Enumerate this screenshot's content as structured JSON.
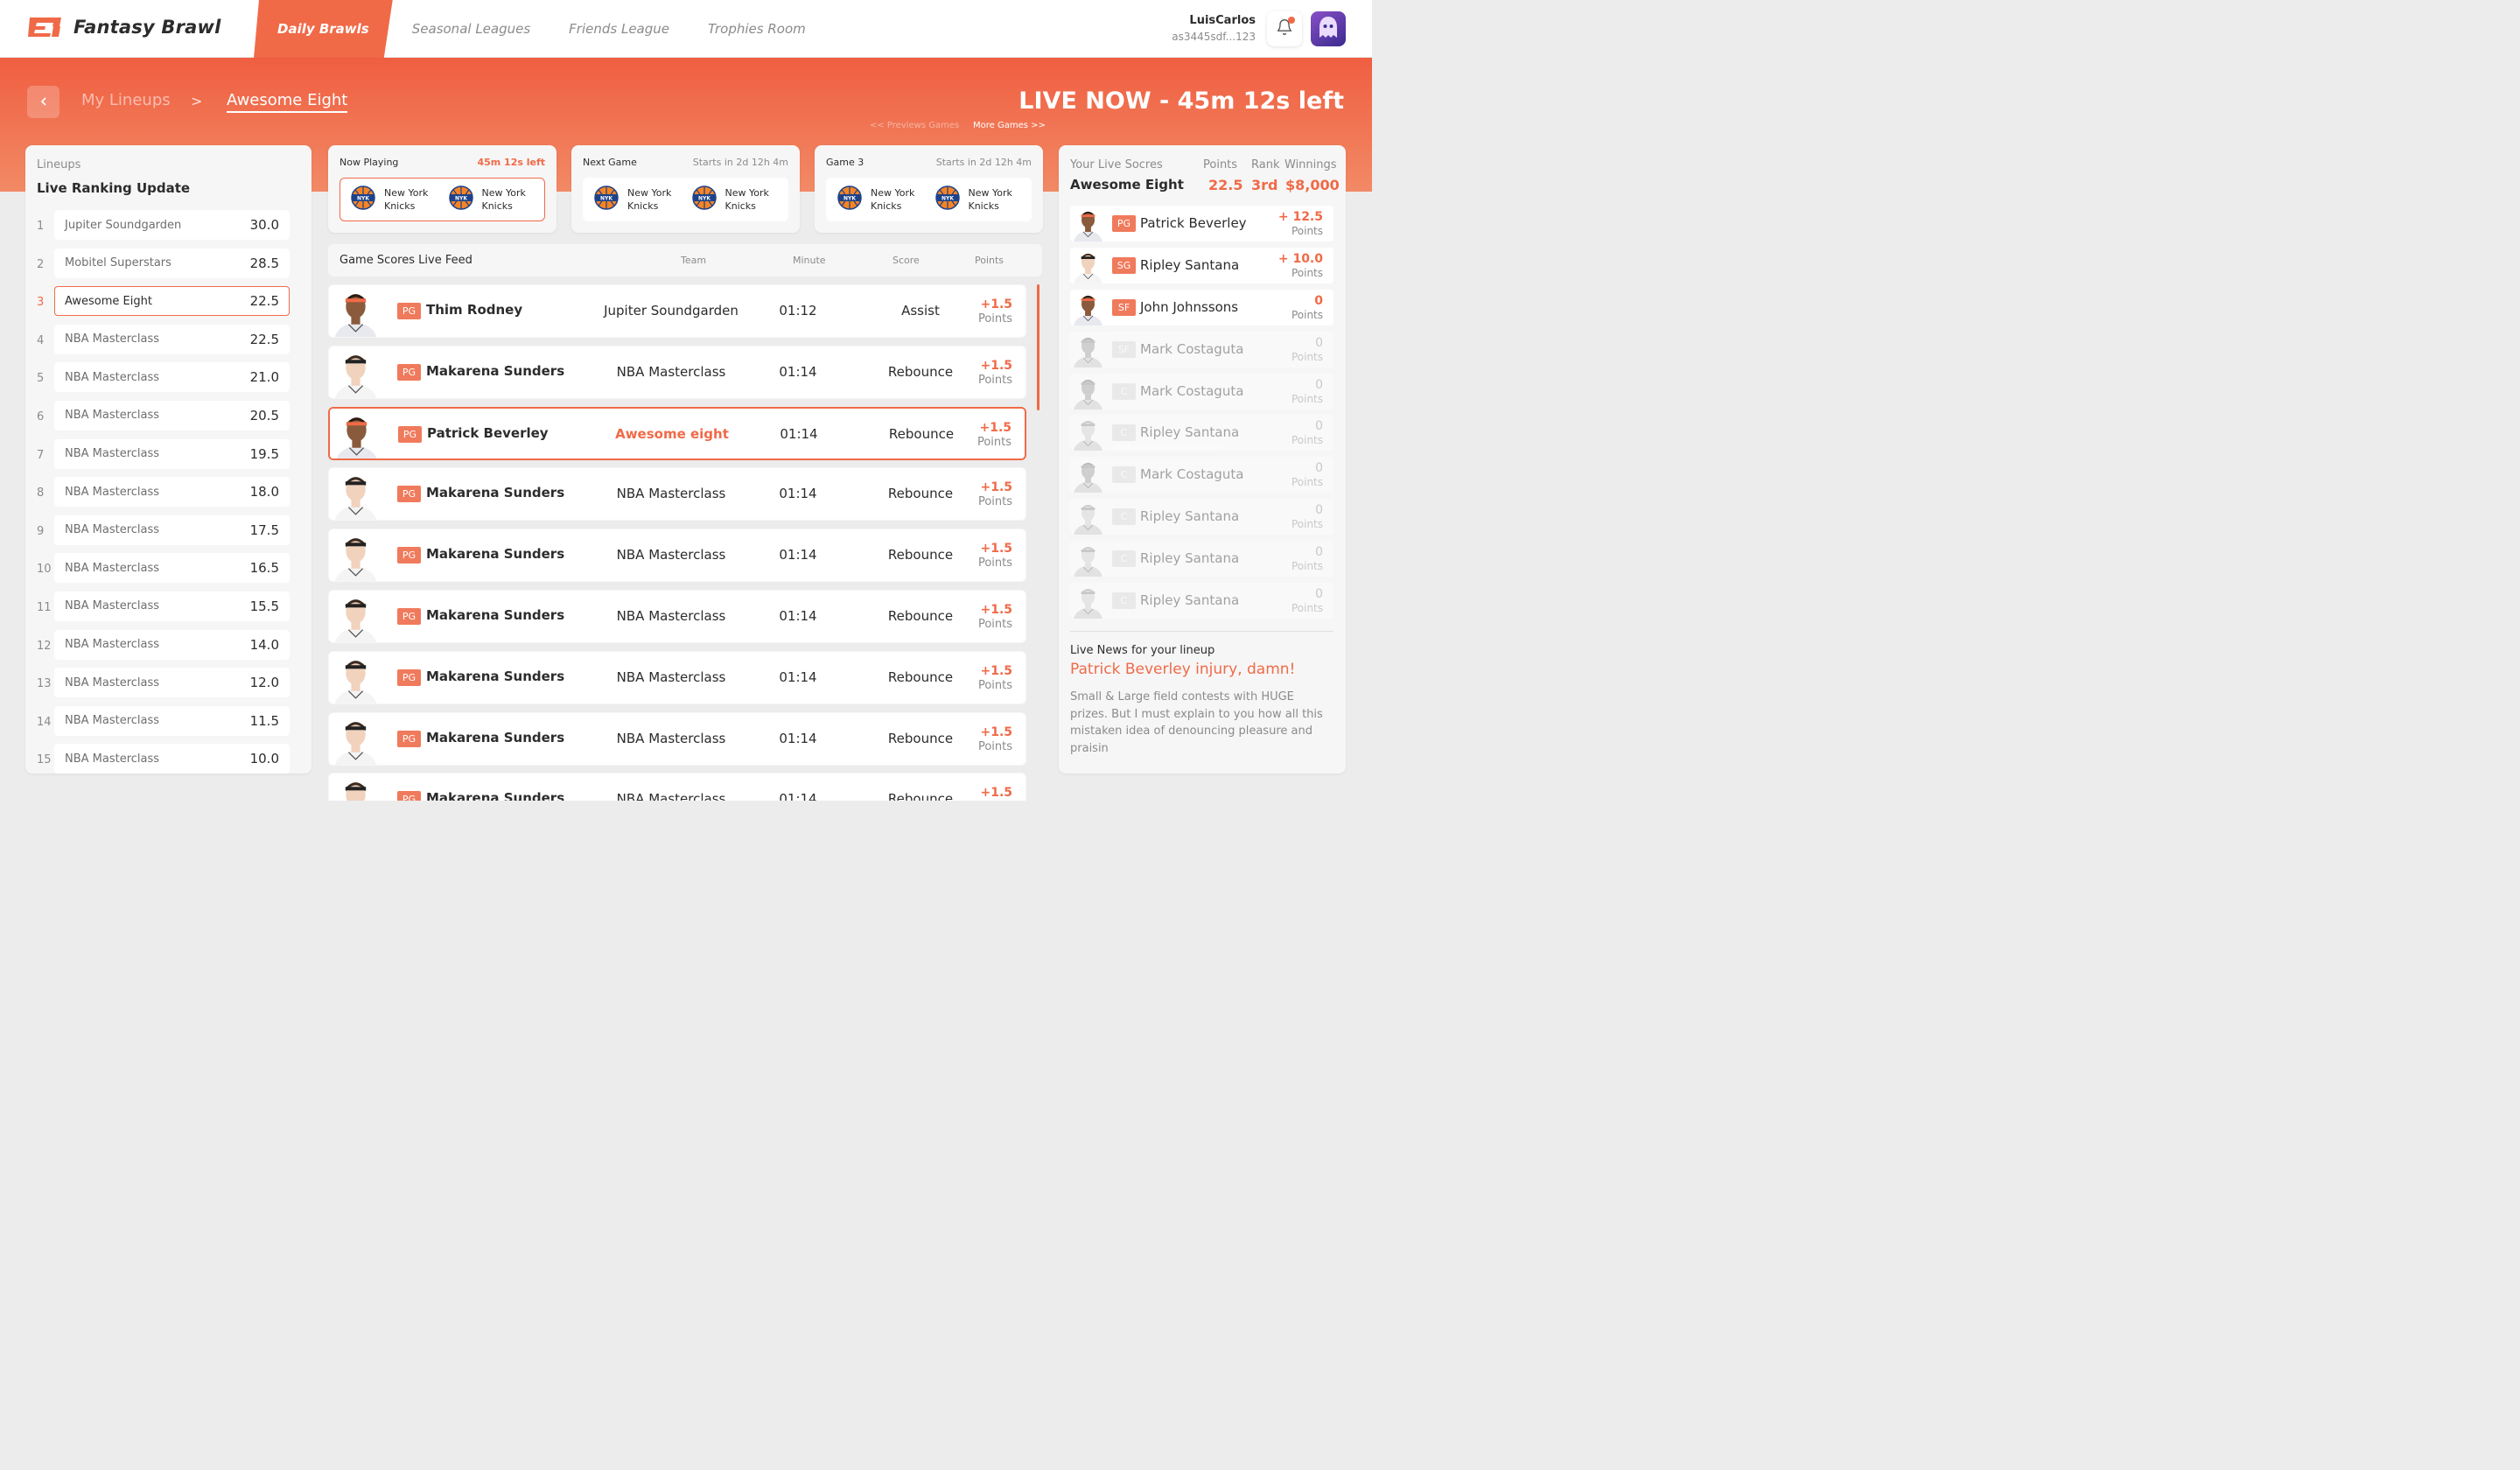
{
  "app": {
    "name": "Fantasy Brawl"
  },
  "nav": [
    {
      "label": "Daily Brawls",
      "active": true
    },
    {
      "label": "Seasonal Leagues",
      "active": false
    },
    {
      "label": "Friends League",
      "active": false
    },
    {
      "label": "Trophies Room",
      "active": false
    }
  ],
  "user": {
    "name": "LuisCarlos",
    "id": "as3445sdf...123"
  },
  "breadcrumb": {
    "parent": "My Lineups",
    "separator": ">",
    "current": "Awesome Eight"
  },
  "live_status": "LIVE NOW - 45m 12s left",
  "games_nav": {
    "prev": "<< Previews Games",
    "more": "More Games >>"
  },
  "rankings": {
    "subtitle": "Lineups",
    "title": "Live Ranking Update",
    "rows": [
      {
        "rank": "1",
        "name": "Jupiter Soundgarden",
        "score": "30.0",
        "active": false
      },
      {
        "rank": "2",
        "name": "Mobitel Superstars",
        "score": "28.5",
        "active": false
      },
      {
        "rank": "3",
        "name": "Awesome Eight",
        "score": "22.5",
        "active": true
      },
      {
        "rank": "4",
        "name": "NBA Masterclass",
        "score": "22.5",
        "active": false
      },
      {
        "rank": "5",
        "name": "NBA Masterclass",
        "score": "21.0",
        "active": false
      },
      {
        "rank": "6",
        "name": "NBA Masterclass",
        "score": "20.5",
        "active": false
      },
      {
        "rank": "7",
        "name": "NBA Masterclass",
        "score": "19.5",
        "active": false
      },
      {
        "rank": "8",
        "name": "NBA Masterclass",
        "score": "18.0",
        "active": false
      },
      {
        "rank": "9",
        "name": "NBA Masterclass",
        "score": "17.5",
        "active": false
      },
      {
        "rank": "10",
        "name": "NBA Masterclass",
        "score": "16.5",
        "active": false
      },
      {
        "rank": "11",
        "name": "NBA Masterclass",
        "score": "15.5",
        "active": false
      },
      {
        "rank": "12",
        "name": "NBA Masterclass",
        "score": "14.0",
        "active": false
      },
      {
        "rank": "13",
        "name": "NBA Masterclass",
        "score": "12.0",
        "active": false
      },
      {
        "rank": "14",
        "name": "NBA Masterclass",
        "score": "11.5",
        "active": false
      },
      {
        "rank": "15",
        "name": "NBA Masterclass",
        "score": "10.0",
        "active": false
      }
    ]
  },
  "games": [
    {
      "label": "Now Playing",
      "time": "45m 12s left",
      "live": true,
      "team1": "New York Knicks",
      "team2": "New York Knicks"
    },
    {
      "label": "Next Game",
      "time": "Starts in 2d 12h 4m",
      "live": false,
      "team1": "New York Knicks",
      "team2": "New York Knicks"
    },
    {
      "label": "Game 3",
      "time": "Starts in 2d 12h 4m",
      "live": false,
      "team1": "New York Knicks",
      "team2": "New York Knicks"
    }
  ],
  "feed": {
    "title": "Game Scores Live Feed",
    "columns": {
      "team": "Team",
      "minute": "Minute",
      "score": "Score",
      "points": "Points"
    },
    "rows": [
      {
        "pos": "PG",
        "player": "Thim Rodney",
        "team": "Jupiter Soundgarden",
        "minute": "01:12",
        "score": "Assist",
        "points": "+1.5",
        "points_label": "Points",
        "highlight": false,
        "photo": "dark"
      },
      {
        "pos": "PG",
        "player": "Makarena Sunders",
        "team": "NBA Masterclass",
        "minute": "01:14",
        "score": "Rebounce",
        "points": "+1.5",
        "points_label": "Points",
        "highlight": false,
        "photo": "light"
      },
      {
        "pos": "PG",
        "player": "Patrick Beverley",
        "team": "Awesome eight",
        "minute": "01:14",
        "score": "Rebounce",
        "points": "+1.5",
        "points_label": "Points",
        "highlight": true,
        "photo": "dark"
      },
      {
        "pos": "PG",
        "player": "Makarena Sunders",
        "team": "NBA Masterclass",
        "minute": "01:14",
        "score": "Rebounce",
        "points": "+1.5",
        "points_label": "Points",
        "highlight": false,
        "photo": "light"
      },
      {
        "pos": "PG",
        "player": "Makarena Sunders",
        "team": "NBA Masterclass",
        "minute": "01:14",
        "score": "Rebounce",
        "points": "+1.5",
        "points_label": "Points",
        "highlight": false,
        "photo": "light"
      },
      {
        "pos": "PG",
        "player": "Makarena Sunders",
        "team": "NBA Masterclass",
        "minute": "01:14",
        "score": "Rebounce",
        "points": "+1.5",
        "points_label": "Points",
        "highlight": false,
        "photo": "light"
      },
      {
        "pos": "PG",
        "player": "Makarena Sunders",
        "team": "NBA Masterclass",
        "minute": "01:14",
        "score": "Rebounce",
        "points": "+1.5",
        "points_label": "Points",
        "highlight": false,
        "photo": "light"
      },
      {
        "pos": "PG",
        "player": "Makarena Sunders",
        "team": "NBA Masterclass",
        "minute": "01:14",
        "score": "Rebounce",
        "points": "+1.5",
        "points_label": "Points",
        "highlight": false,
        "photo": "light"
      },
      {
        "pos": "PG",
        "player": "Makarena Sunders",
        "team": "NBA Masterclass",
        "minute": "01:14",
        "score": "Rebounce",
        "points": "+1.5",
        "points_label": "Points",
        "highlight": false,
        "photo": "light"
      }
    ]
  },
  "live_scores": {
    "subtitle": "Your Live Socres",
    "lineup_name": "Awesome Eight",
    "points_label": "Points",
    "points": "22.5",
    "rank_label": "Rank",
    "rank": "3rd",
    "winnings_label": "Winnings",
    "winnings": "$8,000",
    "players": [
      {
        "pos": "PG",
        "name": "Patrick Beverley",
        "points": "+ 12.5",
        "points_label": "Points",
        "active": true,
        "photo": "dark"
      },
      {
        "pos": "SG",
        "name": "Ripley Santana",
        "points": "+ 10.0",
        "points_label": "Points",
        "active": true,
        "photo": "light"
      },
      {
        "pos": "SF",
        "name": "John Johnssons",
        "points": "0",
        "points_label": "Points",
        "active": true,
        "photo": "dark"
      },
      {
        "pos": "SF",
        "name": "Mark Costaguta",
        "points": "0",
        "points_label": "Points",
        "active": false,
        "photo": "grey"
      },
      {
        "pos": "C",
        "name": "Mark Costaguta",
        "points": "0",
        "points_label": "Points",
        "active": false,
        "photo": "grey"
      },
      {
        "pos": "C",
        "name": "Ripley Santana",
        "points": "0",
        "points_label": "Points",
        "active": false,
        "photo": "greylight"
      },
      {
        "pos": "C",
        "name": "Mark Costaguta",
        "points": "0",
        "points_label": "Points",
        "active": false,
        "photo": "grey"
      },
      {
        "pos": "C",
        "name": "Ripley Santana",
        "points": "0",
        "points_label": "Points",
        "active": false,
        "photo": "greylight"
      },
      {
        "pos": "C",
        "name": "Ripley Santana",
        "points": "0",
        "points_label": "Points",
        "active": false,
        "photo": "greylight"
      },
      {
        "pos": "C",
        "name": "Ripley Santana",
        "points": "0",
        "points_label": "Points",
        "active": false,
        "photo": "greylight"
      }
    ]
  },
  "news": {
    "label": "Live News for your lineup",
    "headline": "Patrick Beverley injury, damn!",
    "body": "Small & Large field contests with HUGE prizes. But I must explain to you how all this mistaken idea of denouncing pleasure and praisin"
  },
  "colors": {
    "accent": "#f06a48",
    "band_top": "#ef5e40",
    "band_bottom": "#f28a66",
    "background": "#ececec",
    "card": "#f6f6f6"
  }
}
